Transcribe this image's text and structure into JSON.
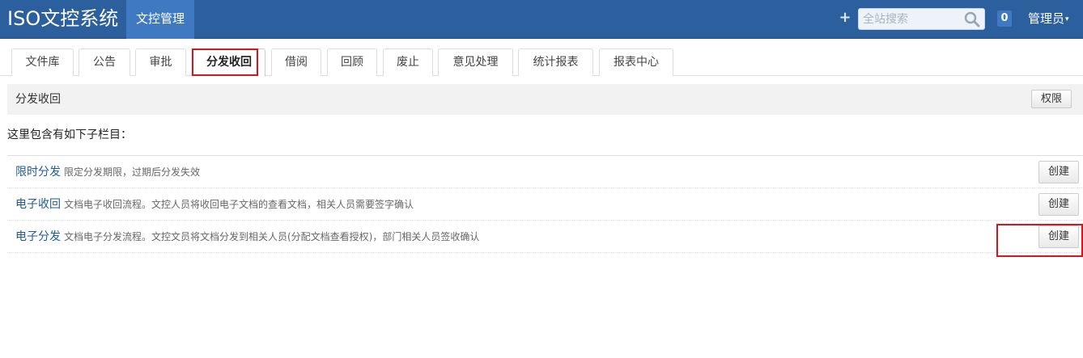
{
  "app": {
    "brand": "ISO文控系统",
    "active_nav": "文控管理",
    "search_placeholder": "全站搜索",
    "badge_count": "0",
    "user_label": "管理员",
    "user_caret": "▾",
    "plus_symbol": "+"
  },
  "tabs": [
    {
      "label": "文件库",
      "active": false
    },
    {
      "label": "公告",
      "active": false
    },
    {
      "label": "审批",
      "active": false
    },
    {
      "label": "分发收回",
      "active": true
    },
    {
      "label": "借阅",
      "active": false
    },
    {
      "label": "回顾",
      "active": false
    },
    {
      "label": "废止",
      "active": false
    },
    {
      "label": "意见处理",
      "active": false
    },
    {
      "label": "统计报表",
      "active": false
    },
    {
      "label": "报表中心",
      "active": false
    }
  ],
  "panel": {
    "title": "分发收回",
    "permission_label": "权限"
  },
  "intro": "这里包含有如下子栏目：",
  "items": [
    {
      "title": "限时分发",
      "description": "限定分发期限，过期后分发失效",
      "action": "创建"
    },
    {
      "title": "电子收回",
      "description": "文档电子收回流程。文控人员将收回电子文档的查看文档，相关人员需要签字确认",
      "action": "创建"
    },
    {
      "title": "电子分发",
      "description": "文档电子分发流程。文控文员将文档分发到相关人员(分配文档查看授权)，部门相关人员签收确认",
      "action": "创建"
    }
  ],
  "colors": {
    "navbar": "#2b5f9e",
    "nav_active": "#3f79c2",
    "link": "#1f5a9c",
    "highlight": "#d9141d"
  }
}
